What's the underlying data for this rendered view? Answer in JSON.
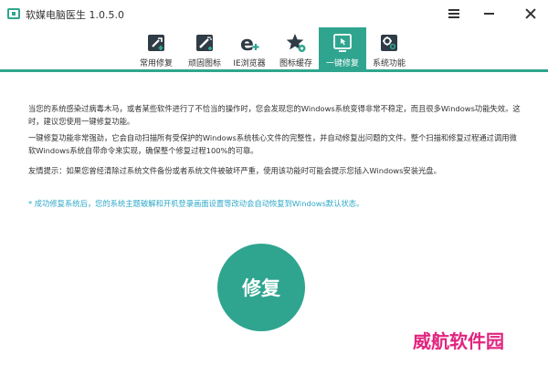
{
  "window": {
    "title": "软媒电脑医生 1.0.5.0"
  },
  "tabs": [
    {
      "label": "常用修复",
      "icon": "wrench-plus-icon",
      "active": false
    },
    {
      "label": "顽固图标",
      "icon": "magic-wand-icon",
      "active": false
    },
    {
      "label": "IE浏览器",
      "icon": "ie-browser-icon",
      "active": false
    },
    {
      "label": "图标缓存",
      "icon": "star-gear-icon",
      "active": false
    },
    {
      "label": "一键修复",
      "icon": "one-click-repair-icon",
      "active": true
    },
    {
      "label": "系统功能",
      "icon": "gears-icon",
      "active": false
    }
  ],
  "content": {
    "p1": "当您的系统感染过病毒木马，或者某些软件进行了不恰当的操作时，您会发现您的Windows系统变得非常不稳定，而且很多Windows功能失效。这时，建议您使用一键修复功能。",
    "p2": "一键修复功能非常强劲，它会自动扫描所有受保护的Windows系统核心文件的完整性，并自动修复出问题的文件。整个扫描和修复过程通过调用微软Windows系统自带命令来实现，确保整个修复过程100%的可靠。",
    "p3": "友情提示：如果您曾经清除过系统文件备份或者系统文件被破坏严重，使用该功能时可能会提示您插入Windows安装光盘。",
    "note": "* 成功修复系统后，您的系统主题破解和开机登录画面设置等改动会自动恢复到Windows默认状态。",
    "repair_button": "修复"
  },
  "watermark": "威航软件园",
  "colors": {
    "accent": "#2fa58f",
    "note": "#2fa8c8",
    "watermark": "#e1257f"
  }
}
